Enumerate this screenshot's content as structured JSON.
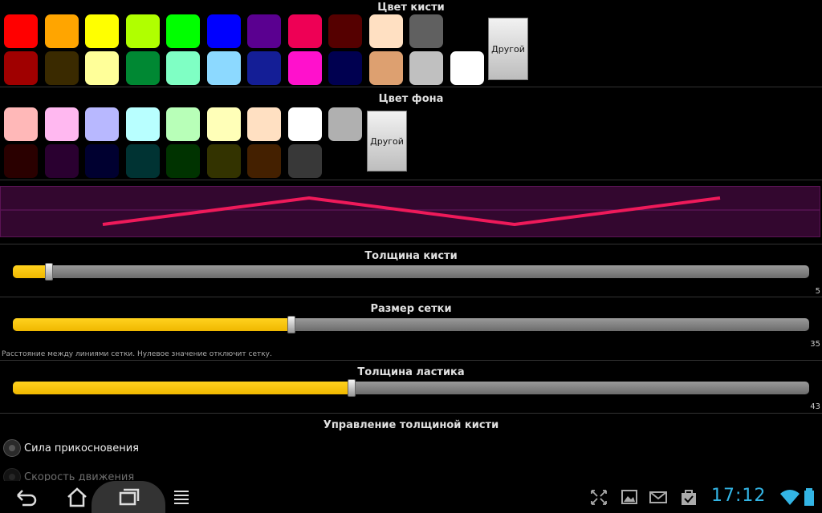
{
  "brush_color": {
    "title": "Цвет кисти",
    "row1": [
      "#ff0000",
      "#ffa500",
      "#ffff00",
      "#b0ff00",
      "#00ff00",
      "#0000ff",
      "#5a0090",
      "#ee0055",
      "#550000",
      "#ffe0c2",
      "#606060",
      "#000000"
    ],
    "row2": [
      "#a00000",
      "#3a2a00",
      "#ffff99",
      "#008833",
      "#7fffc4",
      "#8cd9ff",
      "#141e96",
      "#ff11cc",
      "#000050",
      "#dda070",
      "#c0c0c0",
      "#ffffff"
    ],
    "other_label": "Другой"
  },
  "background_color": {
    "title": "Цвет фона",
    "row1": [
      "#ffb8b8",
      "#ffb8f0",
      "#b8b8ff",
      "#b8ffff",
      "#b8ffb8",
      "#ffffb8",
      "#ffe0c2",
      "#ffffff",
      "#b0b0b0"
    ],
    "row2": [
      "#2a0000",
      "#2a0030",
      "#000030",
      "#003333",
      "#003300",
      "#333300",
      "#442000",
      "#383838",
      "#000000"
    ],
    "other_label": "Другой"
  },
  "preview": {
    "background": "#33072f",
    "stroke": "#ee1a5a"
  },
  "brush_thickness": {
    "title": "Толщина кисти",
    "value": "5",
    "fraction": 0.045
  },
  "grid_size": {
    "title": "Размер сетки",
    "value": "35",
    "fraction": 0.35,
    "hint": "Расстояние между линиями сетки. Нулевое значение отключит сетку."
  },
  "eraser_thickness": {
    "title": "Толщина ластика",
    "value": "43",
    "fraction": 0.425
  },
  "brush_control": {
    "title": "Управление толщиной кисти",
    "options": [
      "Сила прикосновения",
      "Скорость движения"
    ]
  },
  "status": {
    "clock": "17:12"
  },
  "colors": {
    "accent": "#ffc80a",
    "clock": "#33b5e5"
  }
}
